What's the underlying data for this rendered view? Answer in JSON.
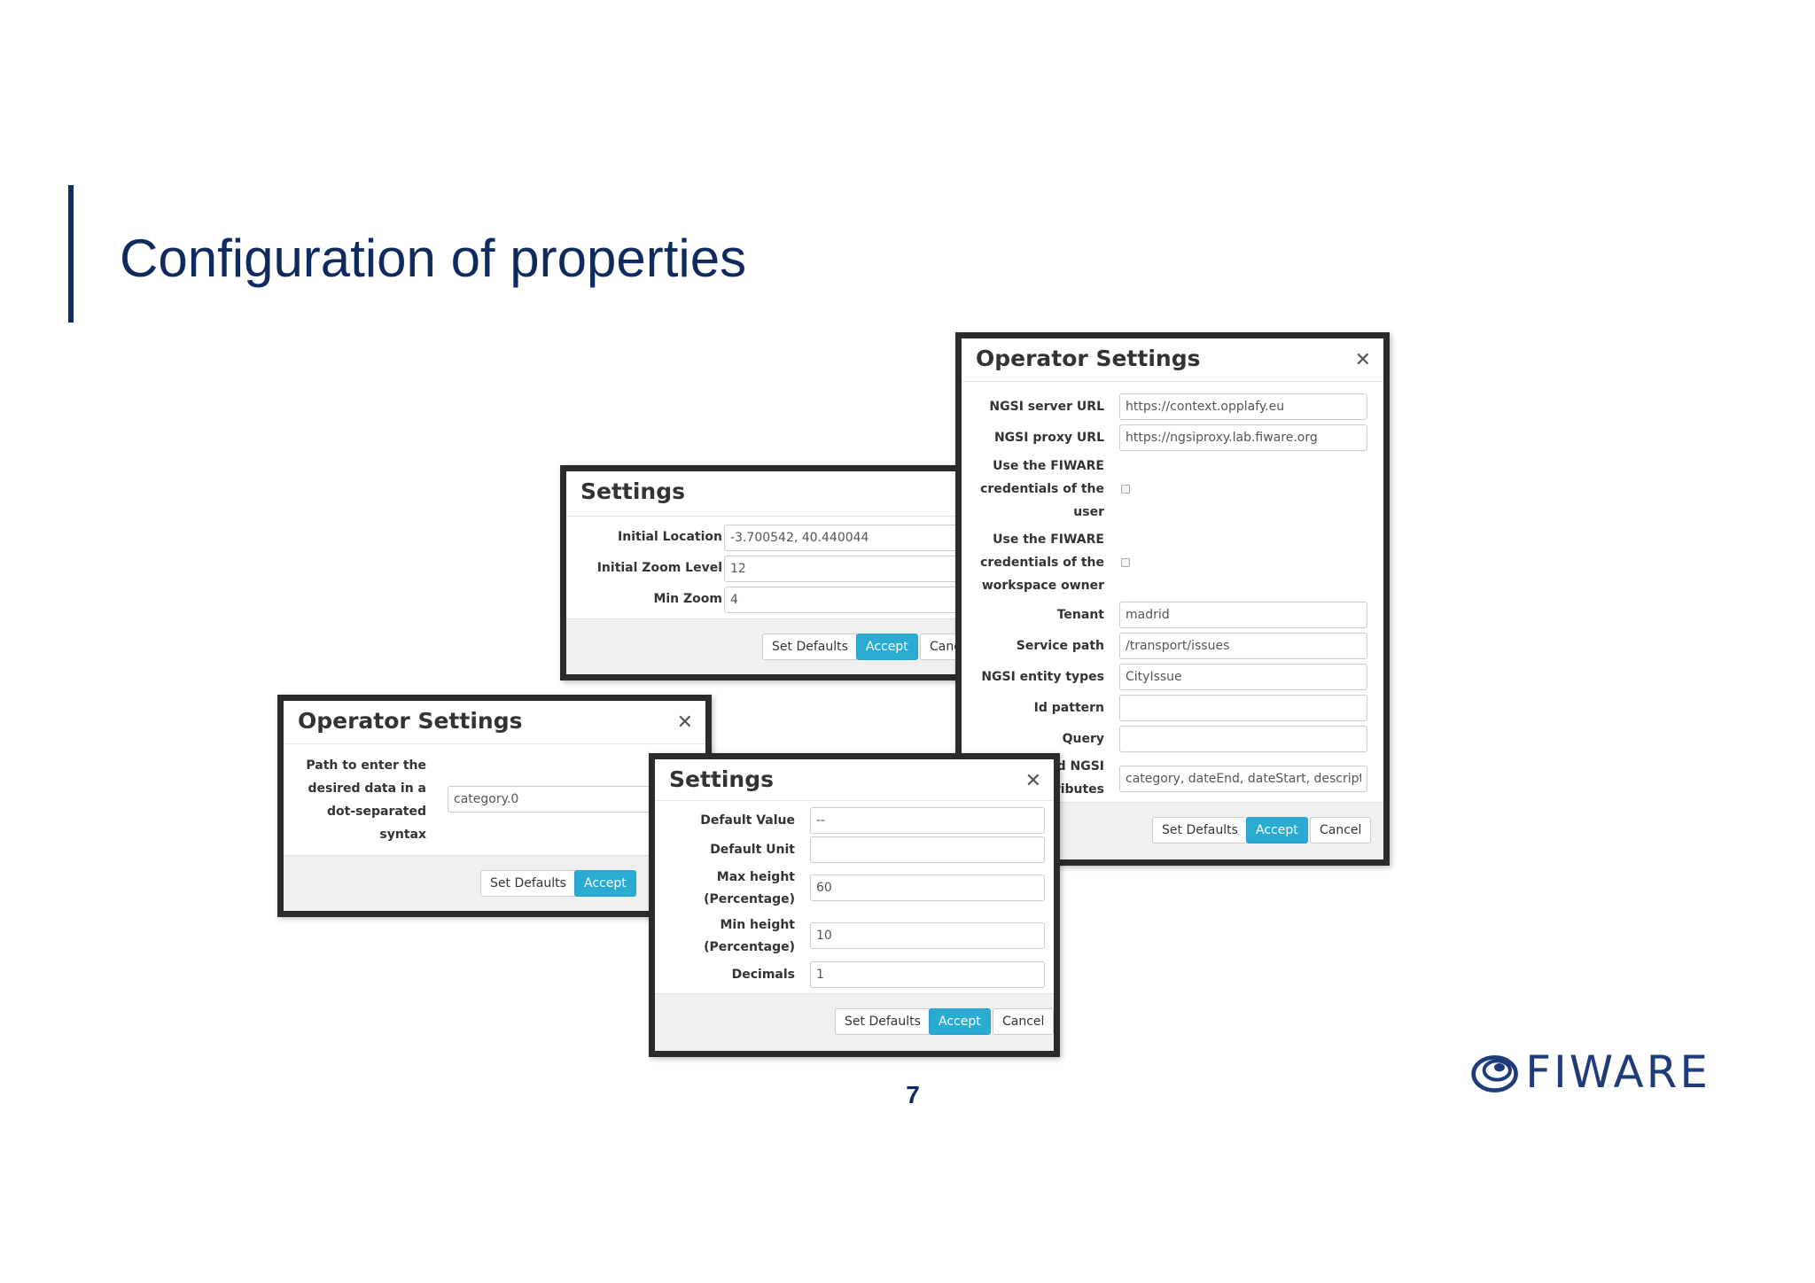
{
  "slide": {
    "title": "Configuration of properties",
    "page_number": "7",
    "logo_text": "FIWARE"
  },
  "colors": {
    "title": "#0e2a5e",
    "accept_button": "#2aabd2",
    "logo": "#1f3b7a"
  },
  "settings_map": {
    "title": "Settings",
    "fields": [
      {
        "label": "Initial Location",
        "value": "-3.700542, 40.440044"
      },
      {
        "label": "Initial Zoom Level",
        "value": "12"
      },
      {
        "label": "Min Zoom",
        "value": "4"
      }
    ],
    "buttons": {
      "defaults": "Set Defaults",
      "accept": "Accept",
      "cancel": "Cancel"
    }
  },
  "operator_ngsi": {
    "title": "Operator Settings",
    "fields": {
      "server_url": {
        "label": "NGSI server URL",
        "value": "https://context.opplafy.eu"
      },
      "proxy_url": {
        "label": "NGSI proxy URL",
        "value": "https://ngsiproxy.lab.fiware.org"
      },
      "use_user_credentials": {
        "label_lines": [
          "Use the FIWARE",
          "credentials of the",
          "user"
        ]
      },
      "use_owner_credentials": {
        "label_lines": [
          "Use the FIWARE",
          "credentials of the",
          "workspace owner"
        ]
      },
      "tenant": {
        "label": "Tenant",
        "value": "madrid"
      },
      "service_path": {
        "label": "Service path",
        "value": "/transport/issues"
      },
      "entity_types": {
        "label": "NGSI entity types",
        "value": "CityIssue"
      },
      "id_pattern": {
        "label": "Id pattern",
        "value": ""
      },
      "query": {
        "label": "Query",
        "value": ""
      },
      "attributes": {
        "label_lines": [
          "red NGSI",
          "tributes"
        ],
        "value": "category, dateEnd, dateStart, description,"
      }
    },
    "buttons": {
      "defaults": "Set Defaults",
      "accept": "Accept",
      "cancel": "Cancel"
    }
  },
  "operator_path": {
    "title": "Operator Settings",
    "label_lines": [
      "Path to enter the",
      "desired data in a",
      "dot-separated",
      "syntax"
    ],
    "value": "category.0",
    "buttons": {
      "defaults": "Set Defaults",
      "accept": "Accept"
    }
  },
  "settings_gauge": {
    "title": "Settings",
    "fields": {
      "default_value": {
        "label": "Default Value",
        "value": "--"
      },
      "default_unit": {
        "label": "Default Unit",
        "value": ""
      },
      "max_height": {
        "label_lines": [
          "Max height",
          "(Percentage)"
        ],
        "value": "60"
      },
      "min_height": {
        "label_lines": [
          "Min height",
          "(Percentage)"
        ],
        "value": "10"
      },
      "decimals": {
        "label": "Decimals",
        "value": "1"
      }
    },
    "buttons": {
      "defaults": "Set Defaults",
      "accept": "Accept",
      "cancel": "Cancel"
    }
  }
}
